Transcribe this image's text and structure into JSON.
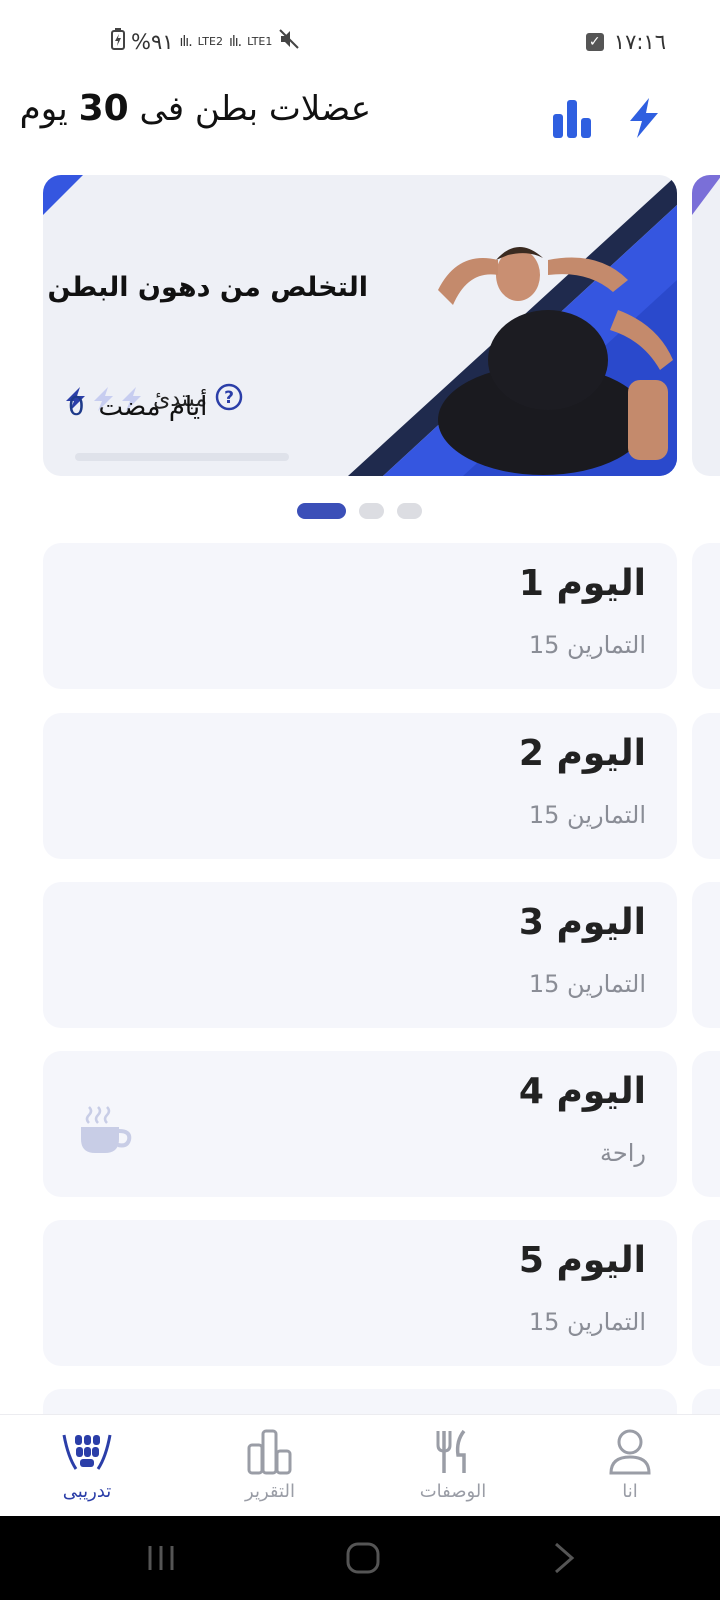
{
  "status_bar": {
    "battery": "%٩١",
    "signal_1": "LTE2",
    "signal_2": "LTE1",
    "time": "١٧:١٦"
  },
  "header": {
    "title_prefix": "عضلات بطن فى",
    "title_number": "30",
    "title_suffix": "يوم",
    "stats_icon": "bar-chart-icon",
    "boost_icon": "lightning-icon",
    "accent": "#2f5fe0"
  },
  "banner": {
    "level_label": "مبتدئ",
    "level_stars_filled": 1,
    "level_stars_total": 3,
    "plan_title": "التخلص من دهون البطن",
    "days_label": "أيام مضت",
    "days_count": "0",
    "progress_fraction": 0
  },
  "carousel": {
    "pages": 3,
    "active": 0
  },
  "days": [
    {
      "title": "اليوم 1",
      "subtitle": "التمارين 15",
      "rest": false
    },
    {
      "title": "اليوم 2",
      "subtitle": "التمارين 15",
      "rest": false
    },
    {
      "title": "اليوم 3",
      "subtitle": "التمارين 15",
      "rest": false
    },
    {
      "title": "اليوم 4",
      "subtitle": "راحة",
      "rest": true,
      "icon": "coffee-cup-icon"
    },
    {
      "title": "اليوم 5",
      "subtitle": "التمارين 15",
      "rest": false
    }
  ],
  "bottom_nav": [
    {
      "label": "تدريبى",
      "icon": "training-icon",
      "active": true
    },
    {
      "label": "التقرير",
      "icon": "report-icon",
      "active": false
    },
    {
      "label": "الوصفات",
      "icon": "recipes-icon",
      "active": false
    },
    {
      "label": "انا",
      "icon": "profile-icon",
      "active": false
    }
  ],
  "system_nav": {
    "recents_icon": "recents-icon",
    "home_icon": "home-icon",
    "back_icon": "back-icon"
  },
  "colors": {
    "active_nav": "#2b3ea8",
    "card_bg": "#f5f6fb",
    "banner_stripe": "#3556e0"
  }
}
